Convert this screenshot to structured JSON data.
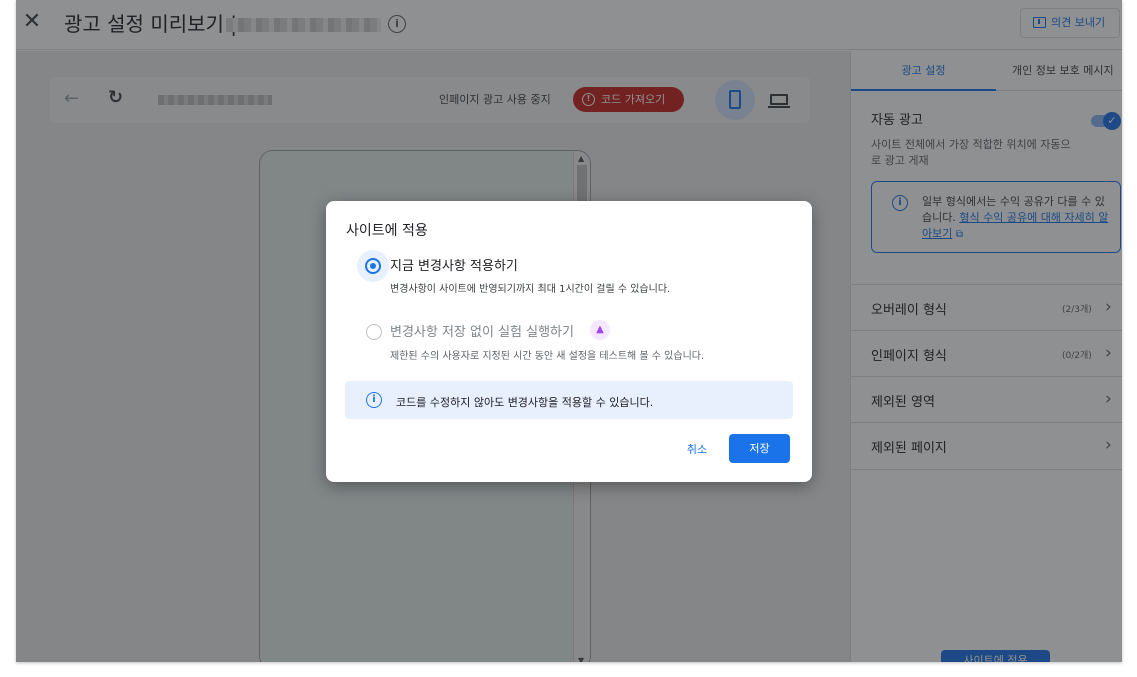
{
  "header": {
    "title": "광고 설정 미리보기 |",
    "feedback_label": "의견 보내기"
  },
  "toolbar": {
    "stop_inpage_label": "인페이지 광고 사용 중지",
    "get_code_label": "코드 가져오기"
  },
  "panel": {
    "tabs": [
      {
        "label": "광고 설정"
      },
      {
        "label": "개인 정보 보호 메시지"
      }
    ],
    "auto_ads": {
      "title": "자동 광고",
      "description": "사이트 전체에서 가장 적합한 위치에 자동으로 광고 게재",
      "enabled": true
    },
    "rev_share": {
      "text": "일부 형식에서는 수익 공유가 다를 수 있습니다. ",
      "link": "형식 수익 공유에 대해 자세히 알아보기"
    },
    "sections": [
      {
        "label": "오버레이 형식",
        "count": "(2/3개)"
      },
      {
        "label": "인페이지 형식",
        "count": "(0/2개)"
      },
      {
        "label": "제외된 영역",
        "count": ""
      },
      {
        "label": "제외된 페이지",
        "count": ""
      }
    ],
    "apply_site_label": "사이트에 적용"
  },
  "dialog": {
    "title": "사이트에 적용",
    "option_now": {
      "label": "지금 변경사항 적용하기",
      "description": "변경사항이 사이트에 반영되기까지 최대 1시간이 걸릴 수 있습니다.",
      "selected": true
    },
    "option_experiment": {
      "label": "변경사항 저장 없이 실험 실행하기",
      "description": "제한된 수의 사용자로 지정된 시간 동안 새 설정을 테스트해 볼 수 있습니다.",
      "selected": false
    },
    "info": "코드를 수정하지 않아도 변경사항을 적용할 수 있습니다.",
    "cancel_label": "취소",
    "save_label": "저장"
  },
  "colors": {
    "accent": "#1a73e8",
    "danger": "#c5221f",
    "overlay": "rgba(32,33,36,0.5)"
  },
  "icons": [
    "close-icon",
    "info-icon",
    "feedback-icon",
    "back-arrow-icon",
    "reload-icon",
    "error-icon",
    "mobile-icon",
    "desktop-icon",
    "check-icon",
    "external-link-icon",
    "chevron-right-icon",
    "flask-icon"
  ]
}
